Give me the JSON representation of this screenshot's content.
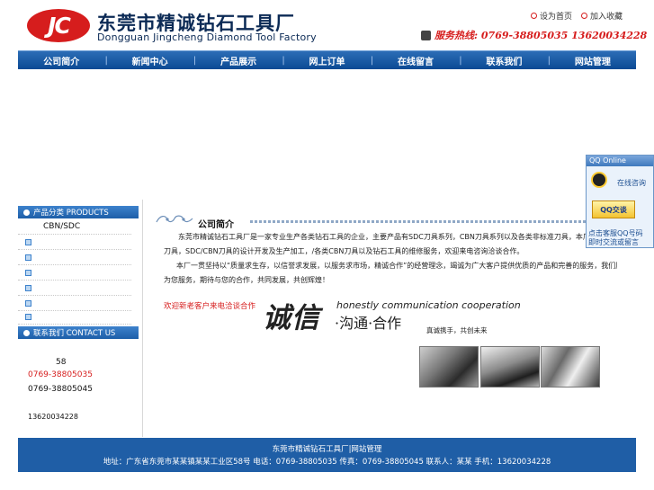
{
  "header": {
    "logo_text": "JC",
    "company_cn": "东莞市精诚钻石工具厂",
    "company_en": "Dongguan Jingcheng Diamond Tool Factory",
    "set_home": "设为首页",
    "add_favorite": "加入收藏",
    "hotline": "服务热线: 0769-38805035 13620034228"
  },
  "nav": {
    "items": [
      "公司简介",
      "新闻中心",
      "产品展示",
      "网上订单",
      "在线留言",
      "联系我们",
      "网站管理"
    ],
    "separator": "|"
  },
  "sidebar": {
    "products_heading": "产品分类 PRODUCTS",
    "products": [
      "CBN/SDC",
      "",
      "",
      "",
      "",
      "",
      ""
    ],
    "contact_heading": "联系我们 CONTACT US",
    "contact_lines": [
      "58",
      "0769-38805035",
      "0769-38805045",
      "13620034228"
    ]
  },
  "main": {
    "about_title": "公司简介",
    "para1_line1": "东莞市精诚钻石工具厂是一家专业生产各类钻石工具的企业，主要产品有SDC刀具系列，CBN刀具系列以及各类非标准刀具，本厂拥有一流的生产设备/专业技术，SDC系列刀具，/各类非标准刀具，CBN系列",
    "para1_line2": "刀具，SDC/CBN刀具的设计开发及生产加工，/各类CBN刀具以及钻石工具的维修服务，欢迎来电咨询洽谈合作。",
    "para2_line1": "本厂一贯坚持以“质量求生存，以信誉求发展，以服务求市场，精诚合作”的经营理念，竭诚为广大客户提供优质的产品和完善的服务，我们愿与各界朋友携手合作，共创美好未来，欢迎新老客户来电来函洽谈业务，我们将竭诚",
    "para2_line2": "为您服务，期待与您的合作，共同发展，共创辉煌！",
    "red_slogan": "欢迎新老客户来电洽谈合作",
    "slogan_cn_big": "诚信",
    "slogan_cn_small": "·沟通·合作",
    "slogan_en": "honestly  communication  cooperation",
    "slogan_sub": "真诚携手，共创未来"
  },
  "qq": {
    "title": "QQ Online",
    "online_label": "在线咨询",
    "button_label": "QQ交谈",
    "footer_line1": "点击客服QQ号码",
    "footer_line2": "即时交流或留言"
  },
  "footer": {
    "line1": "东莞市精诚钻石工具厂|网站管理",
    "line2": "地址：广东省东莞市某某镇某某工业区58号 电话：0769-38805035 传真：0769-38805045 联系人：某某 手机：13620034228"
  },
  "colors": {
    "brand_blue": "#1f5ea6",
    "accent_red": "#d61d1d"
  }
}
